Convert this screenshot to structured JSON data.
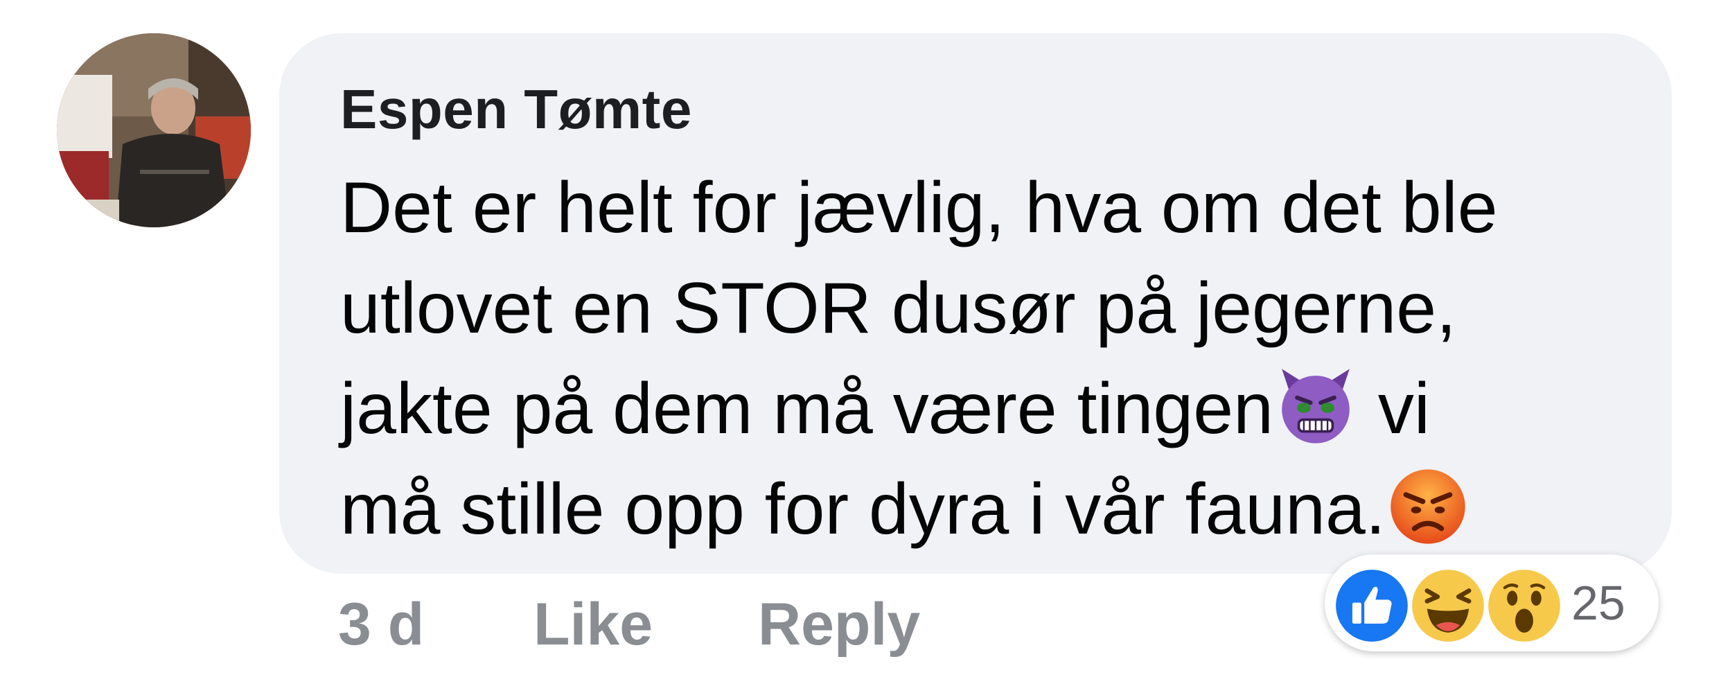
{
  "comment": {
    "author": "Espen Tømte",
    "text_lines": [
      "Det er helt for jævlig, hva om det ble",
      "utlovet en STOR dusør på jegerne,",
      "jakte på dem må være tingen",
      " vi",
      "må stille opp for dyra i vår fauna."
    ],
    "inline_emojis": [
      "smiling-imp-emoji",
      "angry-face-emoji"
    ],
    "timestamp": "3 d",
    "like_label": "Like",
    "reply_label": "Reply"
  },
  "reactions": {
    "icons": [
      "like-reaction-icon",
      "haha-reaction-icon",
      "wow-reaction-icon"
    ],
    "count": "25"
  },
  "colors": {
    "bubble_bg": "#f0f2f5",
    "author_text": "#1c1e21",
    "body_text": "#050505",
    "action_text": "#8a8d91",
    "like_blue": "#1877f2",
    "reaction_yellow": "#f7c94a",
    "angry_red": "#e64a19",
    "imp_purple": "#8e5cc2"
  }
}
